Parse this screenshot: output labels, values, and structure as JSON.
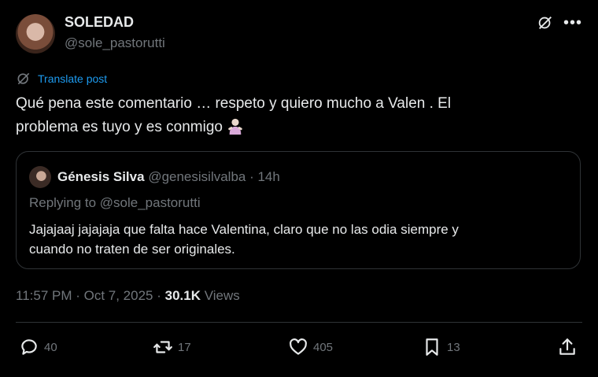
{
  "author": {
    "name": "SOLEDAD",
    "handle": "@sole_pastorutti"
  },
  "translate_label": "Translate post",
  "post": {
    "text_line1": "Qué pena este comentario … respeto y quiero mucho a Valen . El",
    "text_line2": "problema es tuyo y es conmigo"
  },
  "quote": {
    "name": "Génesis Silva",
    "meta": "@genesisilvalba · 14h",
    "replying": "Replying to @sole_pastorutti",
    "text_line1": "Jajajaaj jajajaja que falta hace Valentina, claro que no las odia siempre y",
    "text_line2": "cuando no traten de ser originales."
  },
  "meta": {
    "timestamp": "11:57 PM · Oct 7, 2025 · ",
    "views_count": "30.1K",
    "views_label": " Views"
  },
  "actions": {
    "replies": "40",
    "reposts": "17",
    "likes": "405",
    "bookmarks": "13"
  },
  "colors": {
    "accent": "#1d9bf0",
    "muted": "#71767b",
    "text": "#e7e9ea",
    "border": "#2f3336"
  },
  "icons": [
    "grok-icon",
    "more-icon",
    "translate-icon",
    "reply-icon",
    "repost-icon",
    "like-icon",
    "bookmark-icon",
    "share-icon",
    "woman-gesturing-emoji"
  ]
}
